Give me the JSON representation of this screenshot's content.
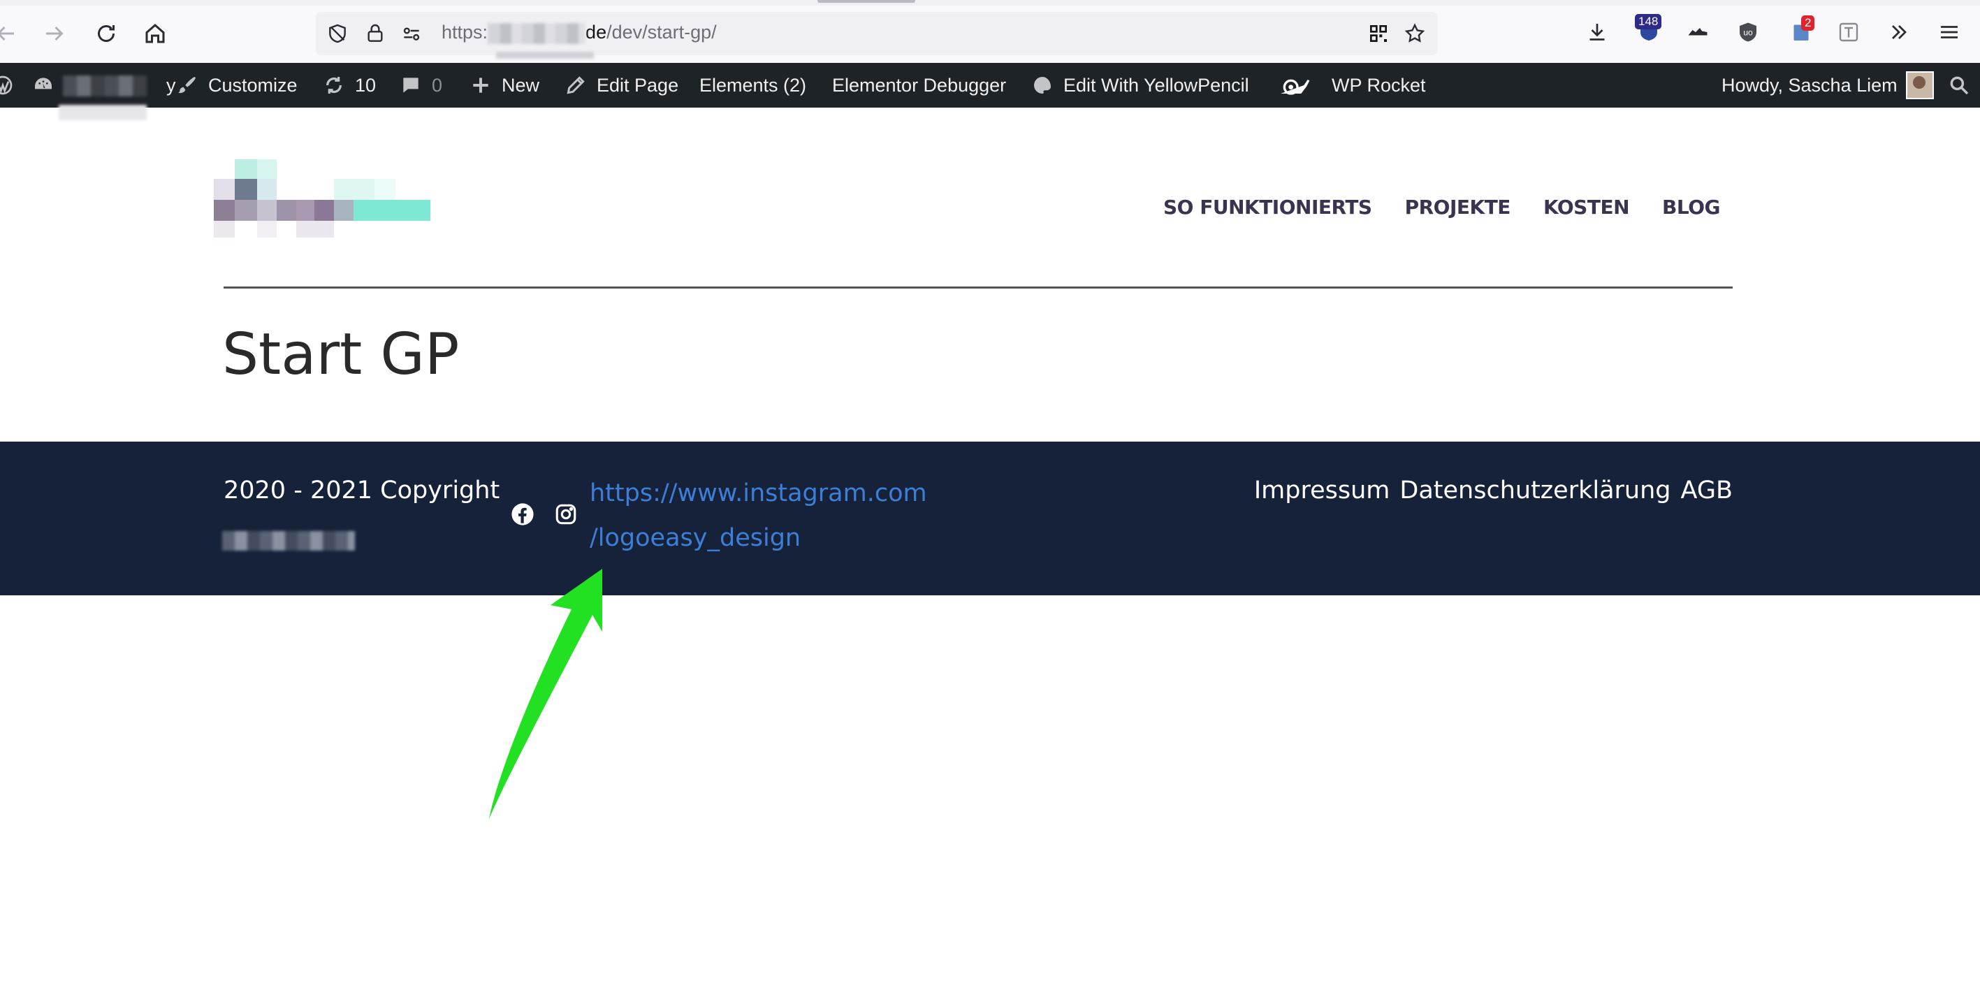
{
  "browser": {
    "url_scheme": "https:",
    "url_host_end": "de",
    "url_path": "/dev/start-gp/",
    "badges": {
      "notifications": "148",
      "extension": "2"
    }
  },
  "admin_bar": {
    "site_suffix": "y",
    "customize": "Customize",
    "updates_count": "10",
    "comments_count": "0",
    "new": "New",
    "edit_page": "Edit Page",
    "elements": "Elements (2)",
    "elementor_debugger": "Elementor Debugger",
    "yellowpencil": "Edit With YellowPencil",
    "wp_rocket": "WP Rocket",
    "howdy": "Howdy, Sascha Liem"
  },
  "site": {
    "nav": [
      "SO FUNKTIONIERTS",
      "PROJEKTE",
      "KOSTEN",
      "BLOG"
    ],
    "page_title": "Start GP"
  },
  "footer": {
    "copyright": "2020 - 2021 Copyright",
    "instagram_link_line1": "https://www.instagram.com",
    "instagram_link_line2": "/logoeasy_design",
    "links": [
      "Impressum",
      "Datenschutzerklärung",
      "AGB"
    ]
  },
  "colors": {
    "admin_bar": "#1d2327",
    "footer_bg": "#16213a",
    "link": "#3d7fd6",
    "nav_text": "#3b3451",
    "annotation_arrow": "#22e022"
  }
}
